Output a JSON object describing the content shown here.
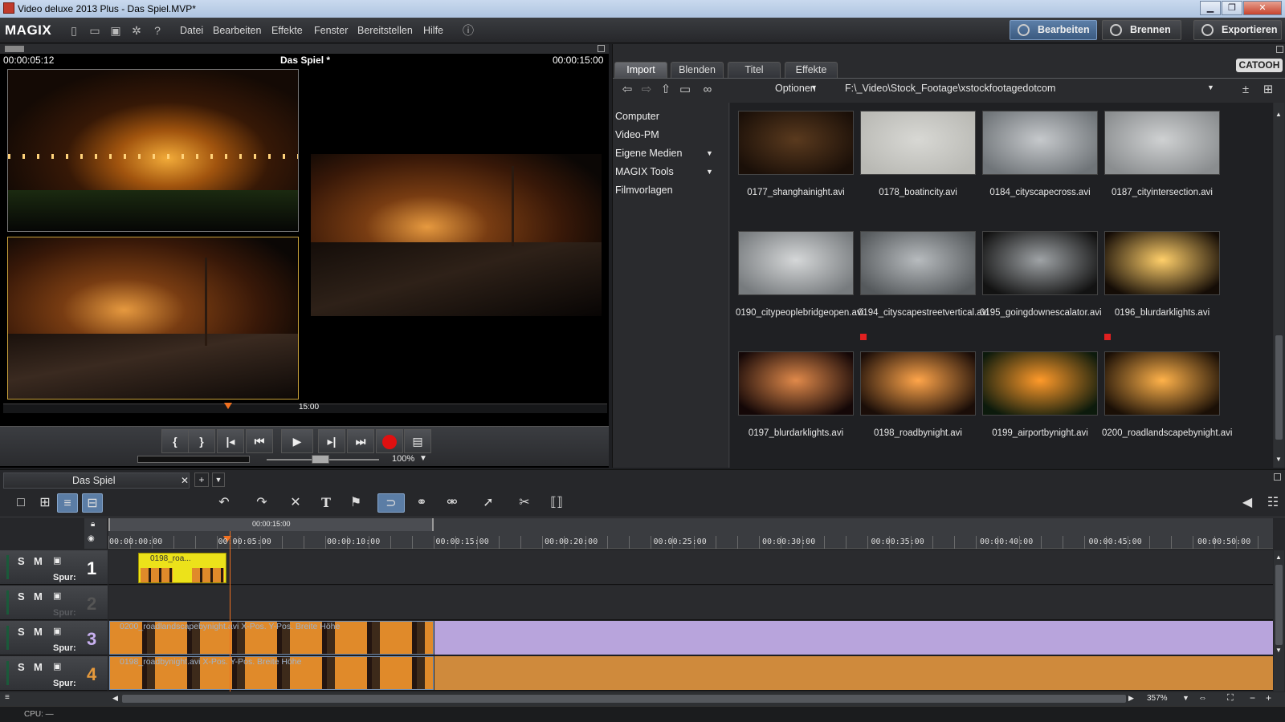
{
  "window": {
    "title": "Video deluxe 2013 Plus - Das Spiel.MVP*"
  },
  "app": {
    "logo": "MAGIX"
  },
  "menu": [
    "Datei",
    "Bearbeiten",
    "Effekte",
    "Fenster",
    "Bereitstellen",
    "Hilfe"
  ],
  "modes": {
    "edit": "Bearbeiten",
    "burn": "Brennen",
    "export": "Exportieren"
  },
  "preview": {
    "timecode_left": "00:00:05:12",
    "title": "Das Spiel *",
    "timecode_right": "00:00:15:00",
    "scrub_label": "15:00",
    "zoom": "100%"
  },
  "media": {
    "tabs": [
      "Import",
      "Blenden",
      "Titel",
      "Effekte"
    ],
    "brand": "CATOOH",
    "options_label": "Optionen",
    "path": "F:\\_Video\\Stock_Footage\\xstockfootagedotcom",
    "tree": [
      "Computer",
      "Video-PM",
      "Eigene Medien",
      "MAGIX Tools",
      "Filmvorlagen"
    ],
    "files": [
      {
        "name": "0177_shanghainight.avi",
        "c1": "#5a3a1e",
        "c2": "#1a0f08"
      },
      {
        "name": "0178_boatincity.avi",
        "c1": "#d8d8d4",
        "c2": "#b9b9b4"
      },
      {
        "name": "0184_cityscapecross.avi",
        "c1": "#c6c9cc",
        "c2": "#6f7478"
      },
      {
        "name": "0187_cityintersection.avi",
        "c1": "#cfd1d2",
        "c2": "#8a8d8f"
      },
      {
        "name": "0190_citypeoplebridgeopen.avi",
        "c1": "#d5d7d8",
        "c2": "#777b7e"
      },
      {
        "name": "0194_cityscapestreetvertical.avi",
        "c1": "#b7bbbe",
        "c2": "#55595c"
      },
      {
        "name": "0195_goingdownescalator.avi",
        "c1": "#9fa3a6",
        "c2": "#121212"
      },
      {
        "name": "0196_blurdarklights.avi",
        "c1": "#ffcf6a",
        "c2": "#140c06"
      },
      {
        "name": "0197_blurdarklights.avi",
        "c1": "#e0894a",
        "c2": "#140707"
      },
      {
        "name": "0198_roadbynight.avi",
        "c1": "#ffa54a",
        "c2": "#1a0d08"
      },
      {
        "name": "0199_airportbynight.avi",
        "c1": "#ff9a2a",
        "c2": "#0c1a0c"
      },
      {
        "name": "0200_roadlandscapebynight.avi",
        "c1": "#ffb24a",
        "c2": "#1a0f06"
      }
    ],
    "marked_indexes": [
      5,
      7
    ]
  },
  "timeline": {
    "tab_title": "Das Spiel",
    "range_label": "00:00:15:00",
    "ruler": [
      "00:00:00:00",
      "00:00:05:00",
      "00:00:10:00",
      "00:00:15:00",
      "00:00:20:00",
      "00:00:25:00",
      "00:00:30:00",
      "00:00:35:00",
      "00:00:40:00",
      "00:00:45:00",
      "00:00:50:00"
    ],
    "spur_label": "Spur:",
    "tracks": [
      {
        "num": "1",
        "color": "#ffffff"
      },
      {
        "num": "2",
        "color": "#555555"
      },
      {
        "num": "3",
        "color": "#c8b0f0"
      },
      {
        "num": "4",
        "color": "#e79a3c"
      }
    ],
    "clips": {
      "track1": "0198_roa...",
      "track3": "0200_roadlandscapebynight.avi  X-Pos. Y-Pos. Breite  Höhe",
      "track4": "0198_roadbynight.avi  X-Pos. Y-Pos. Breite  Höhe"
    },
    "zoom": "357%"
  },
  "status": {
    "cpu": "CPU: —"
  }
}
